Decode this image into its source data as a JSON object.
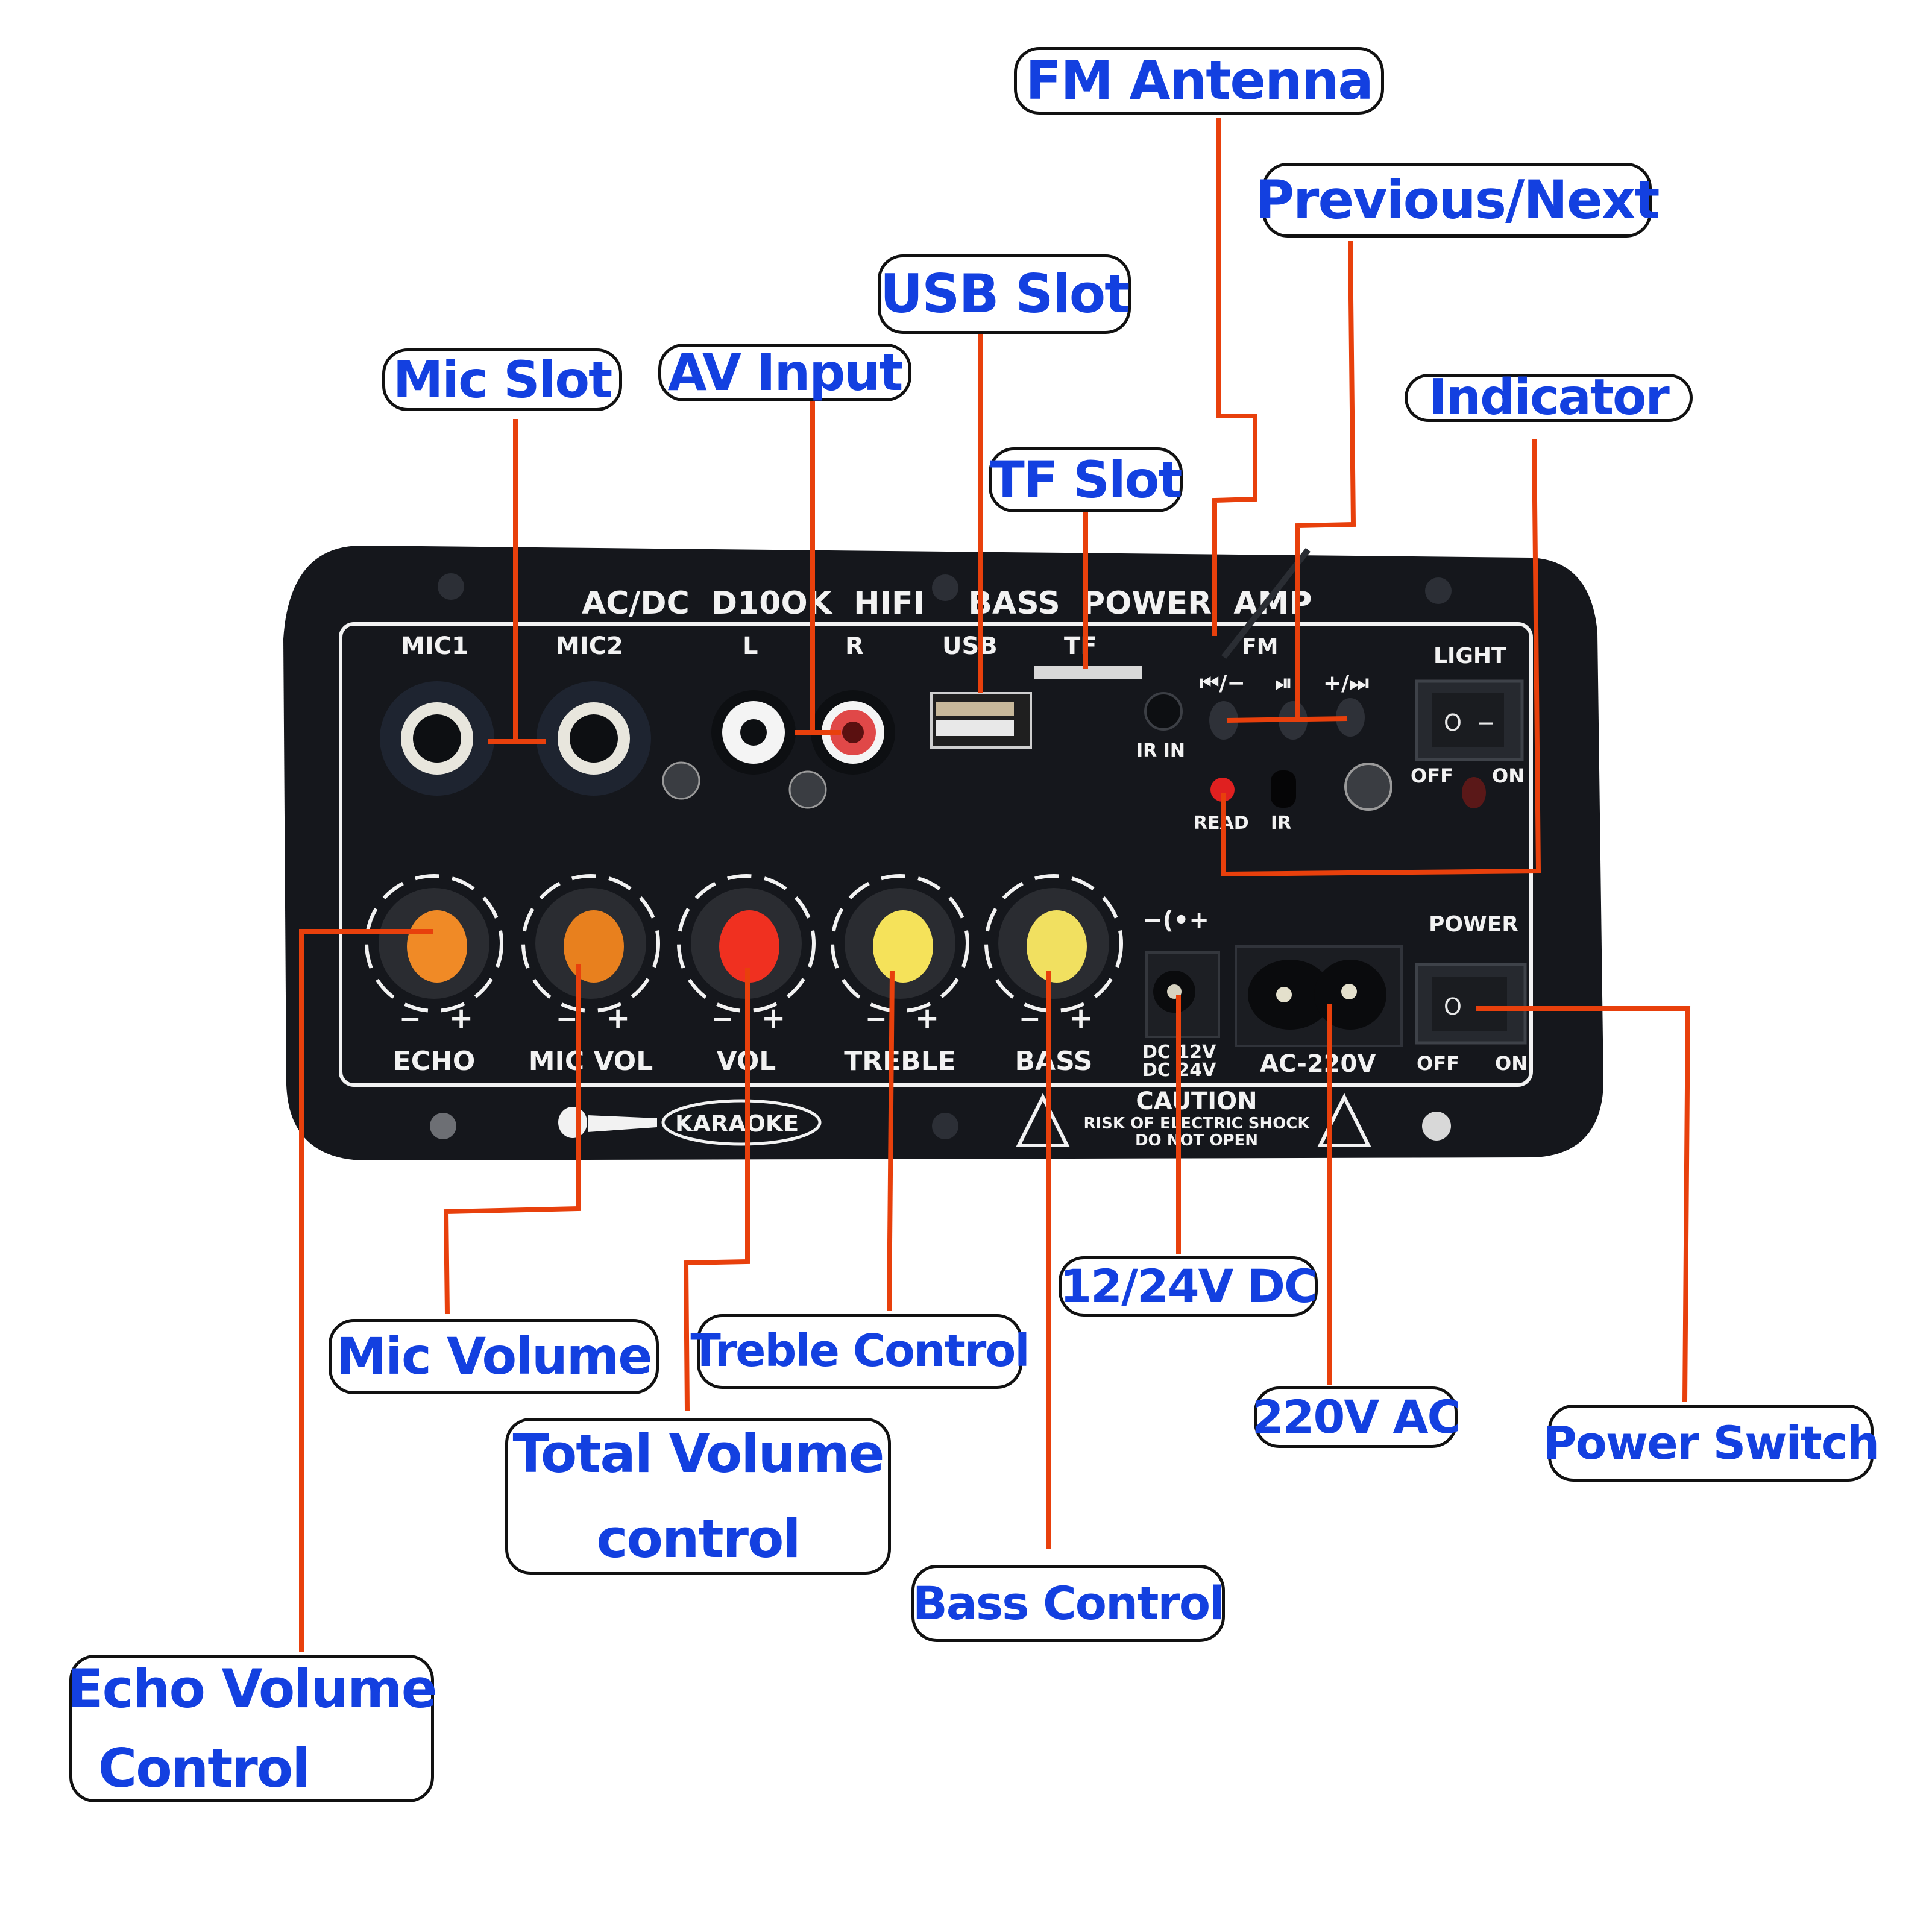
{
  "title": "AC/DC D100K HIFI BASS POWER AMP board — labeled components",
  "colors": {
    "callout_text": "#1340e0",
    "callout_border": "#111111",
    "leader_line": "#e8400c",
    "panel": "#15171c",
    "panel_print": "#f2f2f2",
    "knob_orange": "#f08a26",
    "knob_red": "#f03020",
    "knob_yellow": "#f5e25a",
    "led_red": "#e02020"
  },
  "callouts": {
    "fm_antenna": "FM Antenna",
    "previous_next": "Previous/Next",
    "usb_slot": "USB Slot",
    "mic_slot": "Mic Slot",
    "av_input": "AV Input",
    "tf_slot": "TF Slot",
    "indicator": "Indicator",
    "mic_volume": "Mic Volume",
    "treble_control": "Treble Control",
    "twelve_24v_dc": "12/24V DC",
    "total_volume": [
      "Total Volume",
      "control"
    ],
    "two20v_ac": "220V AC",
    "power_switch": "Power Switch",
    "bass_control": "Bass Control",
    "echo_volume": [
      "Echo Volume",
      "Control"
    ]
  },
  "panel": {
    "header": "AC/DC  D10OK  HIFI    BASS  POWER  AMP",
    "jack_labels": {
      "mic1": "MIC1",
      "mic2": "MIC2",
      "left": "L",
      "right": "R",
      "usb": "USB",
      "tf": "TF",
      "fm": "FM",
      "ir_in": "IR IN",
      "read": "READ",
      "ir": "IR"
    },
    "buttons": {
      "prev": "⏮/−",
      "play_pause": "⏯",
      "next": "+/⏭"
    },
    "light_switch": {
      "title": "LIGHT",
      "off": "OFF",
      "on": "ON",
      "symbols": "O  −"
    },
    "power_switch": {
      "title": "POWER",
      "off": "OFF",
      "on": "ON",
      "symbols": "O  −"
    },
    "knobs": [
      {
        "label": "ECHO",
        "color": "#f08a26",
        "minus": "−",
        "plus": "+"
      },
      {
        "label": "MIC VOL",
        "color": "#e8801e",
        "minus": "−",
        "plus": "+"
      },
      {
        "label": "VOL",
        "color": "#f03020",
        "minus": "−",
        "plus": "+"
      },
      {
        "label": "TREBLE",
        "color": "#f5e25a",
        "minus": "−",
        "plus": "+"
      },
      {
        "label": "BASS",
        "color": "#f1e060",
        "minus": "−",
        "plus": "+"
      }
    ],
    "dc_symbol": "−(•+",
    "dc_label": [
      "DC 12V",
      "DC 24V"
    ],
    "ac_label": "AC-220V",
    "karaoke": "KARAOKE",
    "caution": {
      "title": "CAUTION",
      "line1": "RISK OF ELECTRIC SHOCK",
      "line2": "DO NOT OPEN"
    }
  }
}
